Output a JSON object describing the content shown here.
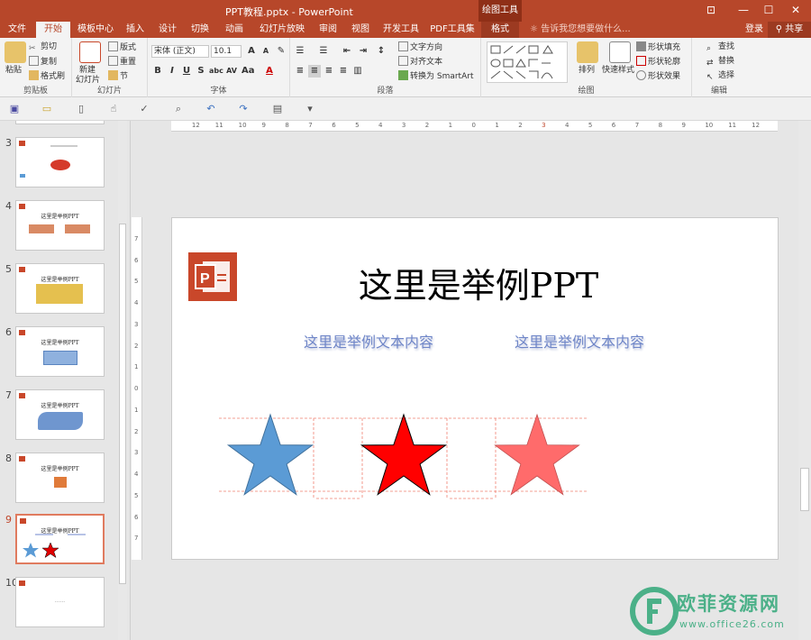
{
  "window": {
    "title": "PPT教程.pptx - PowerPoint",
    "context_tab": "绘图工具",
    "buttons": [
      "⊡",
      "—",
      "☐",
      "✕"
    ]
  },
  "tabs": [
    {
      "label": "文件"
    },
    {
      "label": "开始"
    },
    {
      "label": "模板中心"
    },
    {
      "label": "插入"
    },
    {
      "label": "设计"
    },
    {
      "label": "切换"
    },
    {
      "label": "动画"
    },
    {
      "label": "幻灯片放映"
    },
    {
      "label": "审阅"
    },
    {
      "label": "视图"
    },
    {
      "label": "开发工具"
    },
    {
      "label": "PDF工具集"
    },
    {
      "label": "格式"
    }
  ],
  "tellme": "告诉我您想要做什么...",
  "login": "登录",
  "share": "共享",
  "ribbon": {
    "clipboard": {
      "label": "剪贴板",
      "paste": "粘贴",
      "cut": "剪切",
      "copy": "复制",
      "format_painter": "格式刷"
    },
    "slides": {
      "label": "幻灯片",
      "new_slide": "新建",
      "new_slide_2": "幻灯片",
      "layout": "版式",
      "reset": "重置",
      "section": "节"
    },
    "font": {
      "label": "字体",
      "font_name": "宋体 (正文)",
      "font_size": "10.1"
    },
    "paragraph": {
      "label": "段落",
      "text_direction": "文字方向",
      "align_text": "对齐文本",
      "smartart": "转换为 SmartArt"
    },
    "drawing": {
      "label": "绘图",
      "arrange": "排列",
      "quick_styles": "快速样式",
      "shape_fill": "形状填充",
      "shape_outline": "形状轮廓",
      "shape_effects": "形状效果"
    },
    "editing": {
      "label": "编辑",
      "find": "查找",
      "replace": "替换",
      "select": "选择"
    }
  },
  "thumbnails": [
    {
      "num": "3",
      "title": "这里是举例PPT"
    },
    {
      "num": "4",
      "title": "这里是举例PPT"
    },
    {
      "num": "5",
      "title": "这里是举例PPT"
    },
    {
      "num": "6",
      "title": "这里是举例PPT"
    },
    {
      "num": "7",
      "title": "这里是举例PPT"
    },
    {
      "num": "8",
      "title": "这里是举例PPT"
    },
    {
      "num": "9",
      "title": "这里是举例PPT"
    },
    {
      "num": "10",
      "title": "......"
    }
  ],
  "ruler": {
    "h_labels": [
      "12",
      "11",
      "10",
      "9",
      "8",
      "7",
      "6",
      "5",
      "4",
      "3",
      "2",
      "1",
      "0",
      "1",
      "2",
      "3",
      "4",
      "5",
      "6",
      "7",
      "8",
      "9",
      "10",
      "11",
      "12"
    ],
    "v_labels": [
      "7",
      "6",
      "5",
      "4",
      "3",
      "2",
      "1",
      "0",
      "1",
      "2",
      "3",
      "4",
      "5",
      "6",
      "7"
    ]
  },
  "slide": {
    "title": "这里是举例PPT",
    "text_left": "这里是举例文本内容",
    "text_right": "这里是举例文本内容",
    "star_colors": [
      "#5b9bd5",
      "#ff0000",
      "#ff6b6b"
    ]
  },
  "watermark": {
    "main": "欧菲资源网",
    "sub": "www.office26.com"
  }
}
